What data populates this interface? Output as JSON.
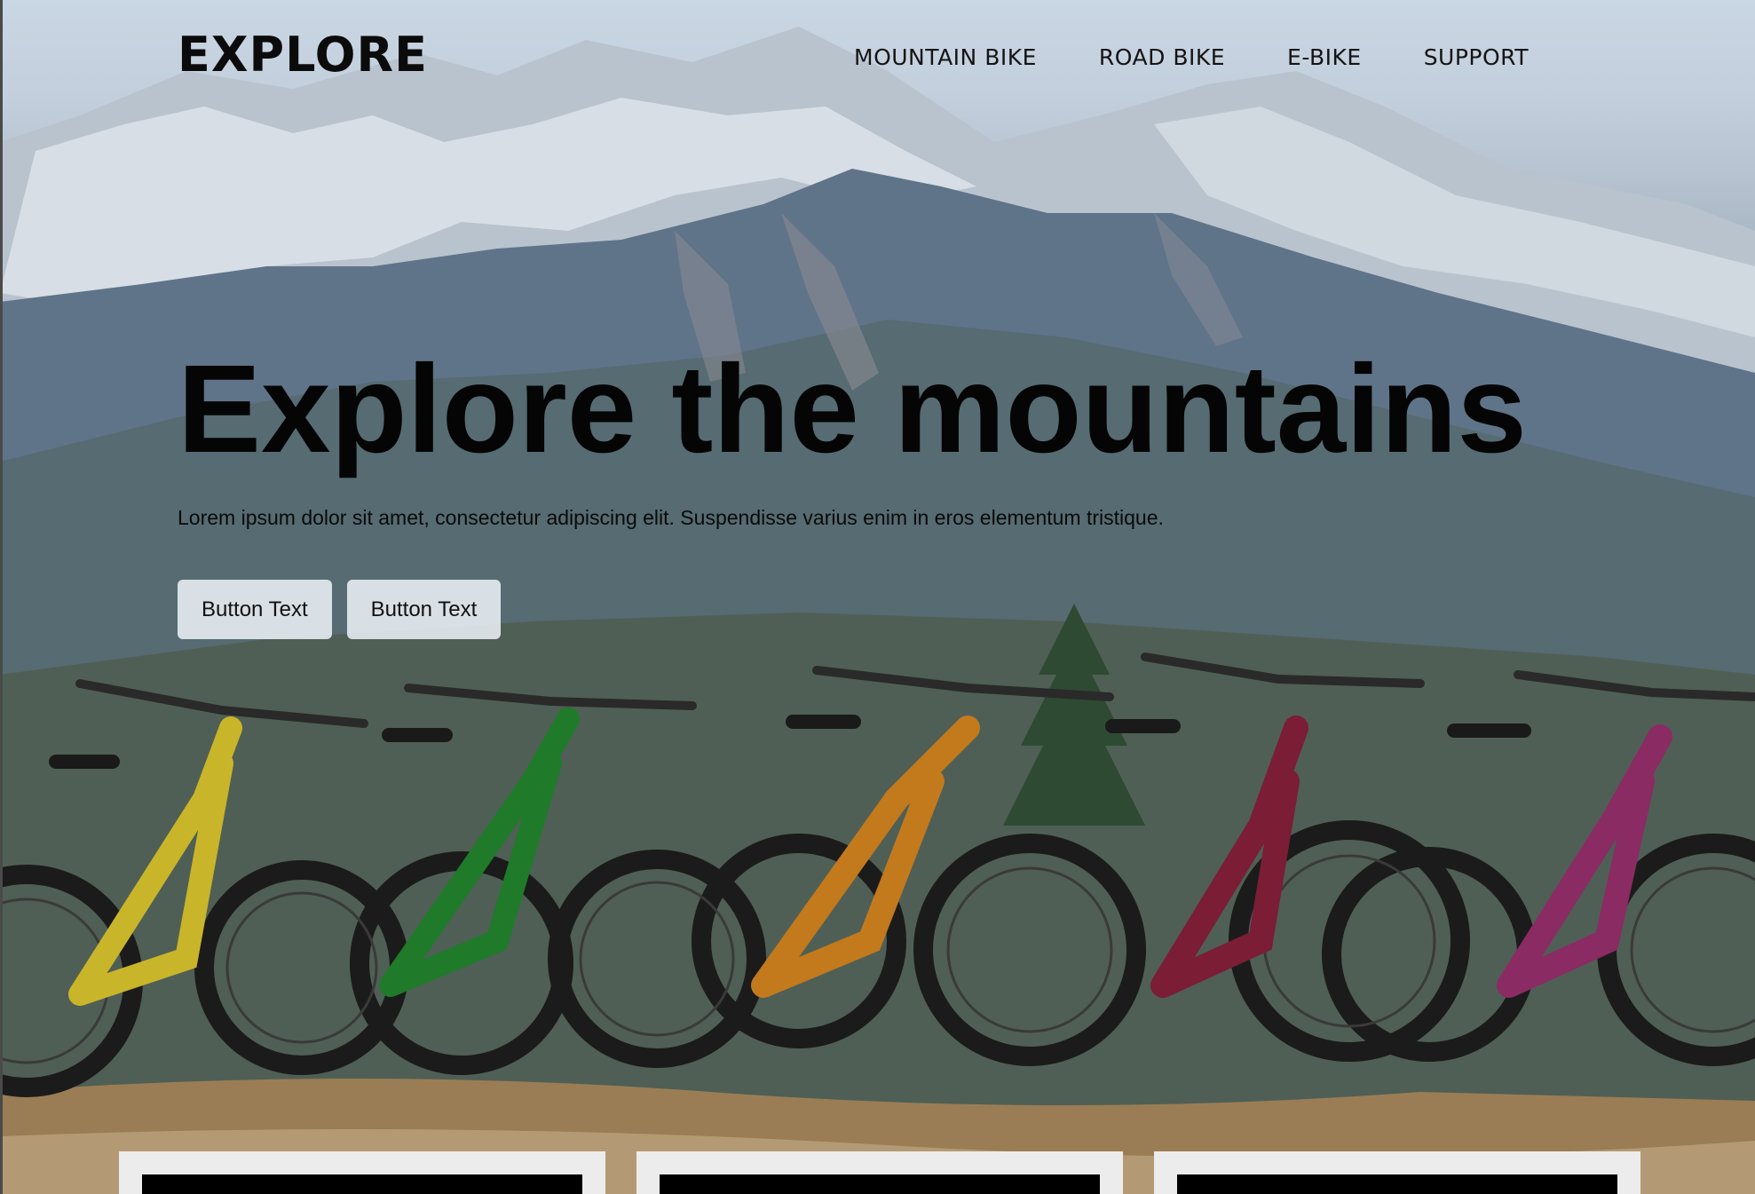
{
  "header": {
    "logo": "EXPLORE",
    "nav": [
      "MOUNTAIN BIKE",
      "ROAD BIKE",
      "E-BIKE",
      "SUPPORT"
    ]
  },
  "hero": {
    "title": "Explore the mountains",
    "text": "Lorem ipsum dolor sit amet, consectetur adipiscing elit. Suspendisse varius enim in eros elementum tristique.",
    "buttons": [
      "Button Text",
      "Button Text"
    ],
    "background": "mountain-bikes-photo"
  },
  "colors": {
    "title": "#050505",
    "button_bg": "#ebf0f6",
    "card_bg": "#ececec",
    "card_bar": "#000000"
  }
}
